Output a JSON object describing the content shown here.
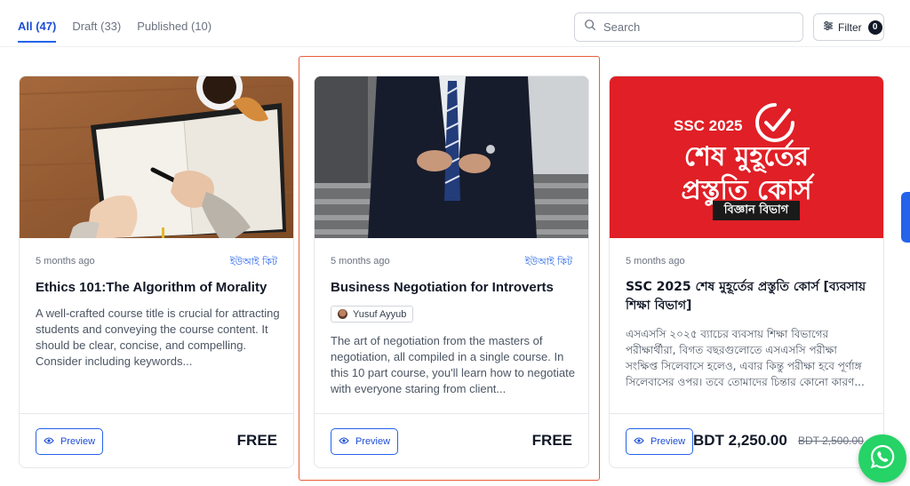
{
  "tabs": [
    {
      "label": "All (47)",
      "active": true
    },
    {
      "label": "Draft (33)",
      "active": false
    },
    {
      "label": "Published (10)",
      "active": false
    }
  ],
  "search": {
    "placeholder": "Search"
  },
  "filter": {
    "label": "Filter",
    "count": "0"
  },
  "cards": [
    {
      "time": "5 months ago",
      "tag": "ইউআই কিট",
      "title": "Ethics 101:The Algorithm of Morality",
      "description": "A well-crafted course title is crucial for attracting students and conveying the course content. It should be clear, concise, and compelling. Consider including keywords...",
      "preview_label": "Preview",
      "price": "FREE"
    },
    {
      "time": "5 months ago",
      "tag": "ইউআই কিট",
      "title": "Business Negotiation for Introverts",
      "author": "Yusuf Ayyub",
      "description": "The art of negotiation from the masters of negotiation, all compiled in a single course. In this 10 part course, you'll learn how to negotiate with everyone staring from client...",
      "preview_label": "Preview",
      "price": "FREE"
    },
    {
      "time": "5 months ago",
      "title": "SSC 2025 শেষ মুহূর্তের প্রস্তুতি কোর্স [ব্যবসায় শিক্ষা বিভাগ]",
      "description": "এসএসসি ২০২৫ ব্যাচের ব্যবসায় শিক্ষা বিভাগের পরীক্ষার্থীরা, বিগত বছরগুলোতে এসএসসি পরীক্ষা সংক্ষিপ্ত সিলেবাসে হলেও, এবার কিন্তু পরীক্ষা হবে পূর্ণাঙ্গ সিলেবাসের ওপর। তবে তোমাদের চিন্তার কোনো কারণ...",
      "preview_label": "Preview",
      "price": "BDT 2,250.00",
      "old_price": "BDT 2,500.00",
      "banner": {
        "line1": "SSC 2025",
        "line2": "শেষ মুহূর্তের",
        "line3": "প্রস্তুতি কোর্স",
        "line4": "বিজ্ঞান বিভাগ"
      }
    }
  ],
  "colors": {
    "accent": "#2563eb",
    "highlight": "#e8603c",
    "banner_red": "#e01f26",
    "whatsapp": "#25d366"
  }
}
